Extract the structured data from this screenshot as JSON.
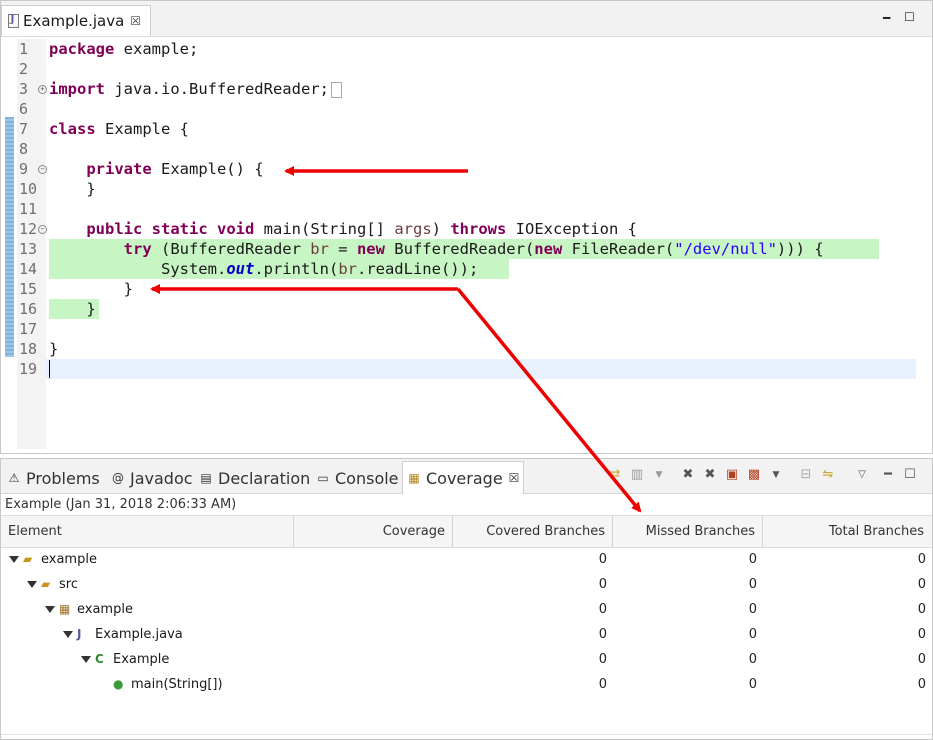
{
  "editor": {
    "tab_label": "Example.java",
    "tab_close": "☒",
    "code": [
      {
        "n": "1",
        "segments": [
          {
            "t": "package",
            "c": "kw"
          },
          {
            "t": " example;",
            "c": ""
          }
        ]
      },
      {
        "n": "2",
        "segments": []
      },
      {
        "n": "3",
        "fold": "+",
        "segments": [
          {
            "t": "import",
            "c": "kw"
          },
          {
            "t": " java.io.BufferedReader;",
            "c": ""
          }
        ],
        "collapsed": true
      },
      {
        "n": "6",
        "segments": []
      },
      {
        "n": "7",
        "segments": [
          {
            "t": "class",
            "c": "kw"
          },
          {
            "t": " Example {",
            "c": ""
          }
        ]
      },
      {
        "n": "8",
        "segments": []
      },
      {
        "n": "9",
        "fold": "−",
        "segments": [
          {
            "t": "    ",
            "c": ""
          },
          {
            "t": "private",
            "c": "kw"
          },
          {
            "t": " Example() {",
            "c": ""
          }
        ]
      },
      {
        "n": "10",
        "segments": [
          {
            "t": "    }",
            "c": ""
          }
        ]
      },
      {
        "n": "11",
        "segments": []
      },
      {
        "n": "12",
        "fold": "−",
        "segments": [
          {
            "t": "    ",
            "c": ""
          },
          {
            "t": "public",
            "c": "kw"
          },
          {
            "t": " ",
            "c": ""
          },
          {
            "t": "static",
            "c": "kw"
          },
          {
            "t": " ",
            "c": ""
          },
          {
            "t": "void",
            "c": "kw"
          },
          {
            "t": " main(String[] ",
            "c": ""
          },
          {
            "t": "args",
            "c": "var"
          },
          {
            "t": ") ",
            "c": ""
          },
          {
            "t": "throws",
            "c": "kw"
          },
          {
            "t": " IOException {",
            "c": ""
          }
        ]
      },
      {
        "n": "13",
        "hl": "full",
        "segments": [
          {
            "t": "        ",
            "c": ""
          },
          {
            "t": "try",
            "c": "kw"
          },
          {
            "t": " (BufferedReader ",
            "c": ""
          },
          {
            "t": "br",
            "c": "var"
          },
          {
            "t": " = ",
            "c": ""
          },
          {
            "t": "new",
            "c": "kw"
          },
          {
            "t": " BufferedReader(",
            "c": ""
          },
          {
            "t": "new",
            "c": "kw"
          },
          {
            "t": " FileReader(",
            "c": ""
          },
          {
            "t": "\"/dev/null\"",
            "c": "str"
          },
          {
            "t": "))) {",
            "c": ""
          }
        ]
      },
      {
        "n": "14",
        "hl": "mid",
        "segments": [
          {
            "t": "            System.",
            "c": ""
          },
          {
            "t": "out",
            "c": "fld"
          },
          {
            "t": ".println(",
            "c": ""
          },
          {
            "t": "br",
            "c": "var"
          },
          {
            "t": ".readLine());",
            "c": ""
          }
        ]
      },
      {
        "n": "15",
        "segments": [
          {
            "t": "        }",
            "c": ""
          }
        ]
      },
      {
        "n": "16",
        "hl": "short",
        "segments": [
          {
            "t": "    }",
            "c": ""
          }
        ]
      },
      {
        "n": "17",
        "segments": []
      },
      {
        "n": "18",
        "segments": [
          {
            "t": "}",
            "c": ""
          }
        ]
      },
      {
        "n": "19",
        "segments": [],
        "current": true
      }
    ]
  },
  "panel": {
    "tabs": [
      {
        "label": "Problems",
        "icon": "problems-icon"
      },
      {
        "label": "Javadoc",
        "icon": "javadoc-icon"
      },
      {
        "label": "Declaration",
        "icon": "declaration-icon"
      },
      {
        "label": "Console",
        "icon": "console-icon"
      },
      {
        "label": "Coverage",
        "icon": "coverage-icon",
        "active": true
      }
    ],
    "coverage_close": "☒",
    "session_label": "Example (Jan 31, 2018 2:06:33 AM)",
    "columns": [
      "Element",
      "Coverage",
      "Covered Branches",
      "Missed Branches",
      "Total Branches"
    ],
    "rows": [
      {
        "label": "example",
        "level": 0,
        "icon": "project-icon",
        "expanded": true,
        "covered": "0",
        "missed": "0",
        "total": "0"
      },
      {
        "label": "src",
        "level": 1,
        "icon": "source-folder-icon",
        "expanded": true,
        "covered": "0",
        "missed": "0",
        "total": "0"
      },
      {
        "label": "example",
        "level": 2,
        "icon": "package-icon",
        "expanded": true,
        "covered": "0",
        "missed": "0",
        "total": "0"
      },
      {
        "label": "Example.java",
        "level": 3,
        "icon": "java-file-icon",
        "expanded": true,
        "covered": "0",
        "missed": "0",
        "total": "0"
      },
      {
        "label": "Example",
        "level": 4,
        "icon": "class-icon",
        "expanded": true,
        "covered": "0",
        "missed": "0",
        "total": "0"
      },
      {
        "label": "main(String[])",
        "level": 5,
        "icon": "method-icon",
        "expanded": false,
        "covered": "0",
        "missed": "0",
        "total": "0"
      }
    ]
  },
  "colors": {
    "keyword": "#7f0055",
    "string": "#2a00ff",
    "coverage_green": "#c8f5c4",
    "annotation_arrow": "#ee0000"
  }
}
